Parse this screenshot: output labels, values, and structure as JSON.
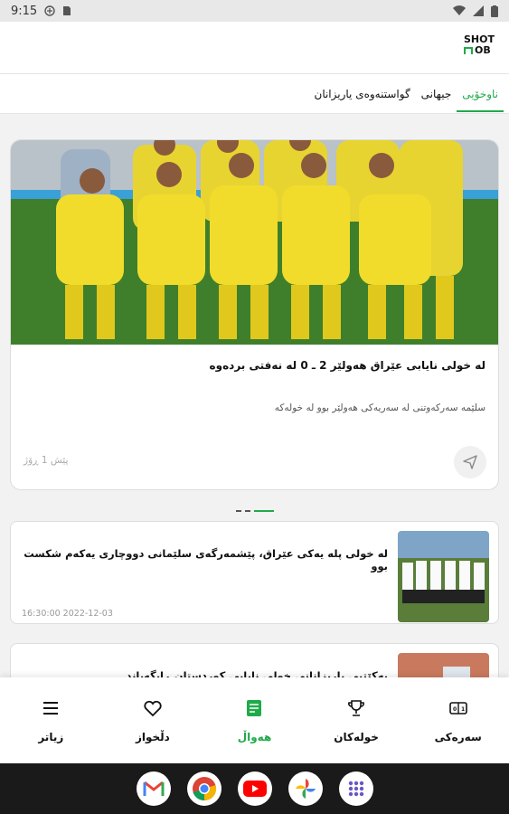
{
  "status_bar": {
    "time": "9:15"
  },
  "app": {
    "logo_line1": "SHOT",
    "logo_line2": "OB"
  },
  "tabs": [
    {
      "label": "ناوخۆیی",
      "active": true
    },
    {
      "label": "جیهانی",
      "active": false
    },
    {
      "label": "گواستنەوەی یاریزانان",
      "active": false
    }
  ],
  "featured": {
    "title": "لە خولی نایابی عێراق هەولێر 2 ـ 0 لە نەفتی بردەوە",
    "subtitle": "سلێمە سەرکەوتنی لە سەریەکی هەولێر بوو لە خولەکە",
    "time": "پێش 1 ڕۆژ"
  },
  "news": [
    {
      "title": "لە خولی پلە یەکی عێراق، پێشمەرگەی سلێمانی دووچاری یەکەم شکست بوو",
      "time": "16:30:00 2022-12-03"
    },
    {
      "title": "یەکێتیی یاریزانانی خولی نایابی کوردستان ڕایگەیاند",
      "time": ""
    }
  ],
  "bottom_nav": [
    {
      "label": "سەرەکی",
      "icon": "scoreboard-icon",
      "active": false
    },
    {
      "label": "خولەکان",
      "icon": "trophy-icon",
      "active": false
    },
    {
      "label": "هەواڵ",
      "icon": "news-icon",
      "active": true
    },
    {
      "label": "دڵخواز",
      "icon": "heart-icon",
      "active": false
    },
    {
      "label": "زیاتر",
      "icon": "menu-icon",
      "active": false
    }
  ],
  "colors": {
    "accent": "#1faa4a"
  }
}
